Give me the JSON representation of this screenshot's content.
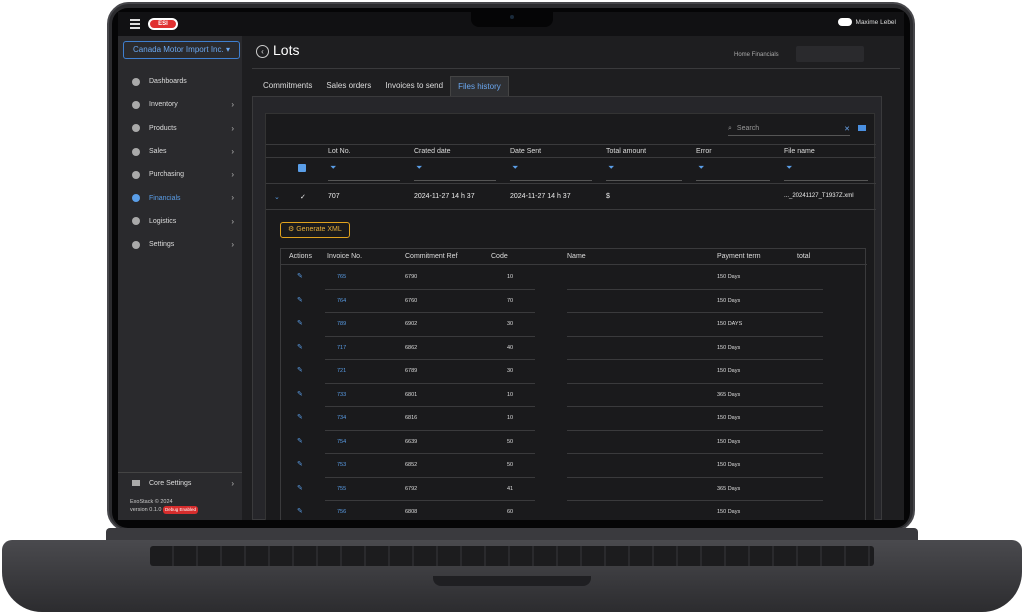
{
  "app": {
    "logo_text": "ESI",
    "user_name": "Maxime Lebel",
    "company": "Canada Motor Import Inc. ▾",
    "nav": [
      {
        "label": "Dashboards",
        "chevron": ""
      },
      {
        "label": "Inventory",
        "chevron": "›"
      },
      {
        "label": "Products",
        "chevron": "›"
      },
      {
        "label": "Sales",
        "chevron": "›"
      },
      {
        "label": "Purchasing",
        "chevron": "›"
      },
      {
        "label": "Financials",
        "chevron": "›"
      },
      {
        "label": "Logistics",
        "chevron": "›"
      },
      {
        "label": "Settings",
        "chevron": "›"
      }
    ],
    "core_settings": "Core Settings",
    "footer_line1": "ExoStack © 2024",
    "footer_line2": "version 0.1.0",
    "debug_badge": "Debug Enabled"
  },
  "page": {
    "back": "‹",
    "title": "Lots",
    "breadcrumb": "Home   Financials",
    "tabs": [
      "Commitments",
      "Sales orders",
      "Invoices to send",
      "Files history"
    ],
    "search_placeholder": "Search",
    "search_close": "✕"
  },
  "table": {
    "columns": [
      "Lot No.",
      "Crated date",
      "Date Sent",
      "Total amount",
      "Error",
      "File name"
    ],
    "row": {
      "expand": "⌄",
      "check": "✓",
      "lot": "707",
      "created": "2024-11-27 14 h 37",
      "sent": "2024-11-27 14 h 37",
      "total": "$",
      "error": "",
      "file": "..._20241127_T1937Z.xml"
    },
    "generate_button": "Generate XML"
  },
  "subtable": {
    "columns": [
      "Actions",
      "Invoice No.",
      "Commitment Ref",
      "Code",
      "Name",
      "Payment term",
      "total"
    ],
    "rows": [
      {
        "inv": "765",
        "ref": "6790",
        "code": "10",
        "term": "150 Days"
      },
      {
        "inv": "764",
        "ref": "6760",
        "code": "70",
        "term": "150 Days"
      },
      {
        "inv": "789",
        "ref": "6902",
        "code": "30",
        "term": "150 DAYS"
      },
      {
        "inv": "717",
        "ref": "6862",
        "code": "40",
        "term": "150 Days"
      },
      {
        "inv": "721",
        "ref": "6789",
        "code": "30",
        "term": "150 Days"
      },
      {
        "inv": "733",
        "ref": "6801",
        "code": "10",
        "term": "365 Days"
      },
      {
        "inv": "734",
        "ref": "6816",
        "code": "10",
        "term": "150 Days"
      },
      {
        "inv": "754",
        "ref": "6639",
        "code": "50",
        "term": "150 Days"
      },
      {
        "inv": "753",
        "ref": "6852",
        "code": "50",
        "term": "150 Days"
      },
      {
        "inv": "755",
        "ref": "6792",
        "code": "41",
        "term": "365 Days"
      },
      {
        "inv": "756",
        "ref": "6808",
        "code": "60",
        "term": "150 Days"
      }
    ]
  }
}
